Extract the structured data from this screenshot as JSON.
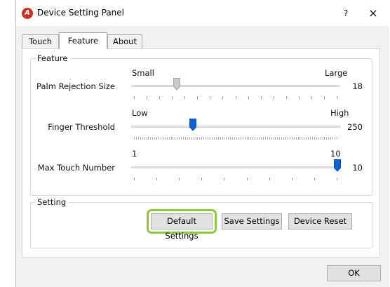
{
  "window": {
    "title": "Device Setting Panel",
    "help_symbol": "?",
    "close_symbol": "×",
    "icon": "app-logo-icon"
  },
  "tabs": [
    {
      "label": "Touch",
      "selected": false
    },
    {
      "label": "Feature",
      "selected": true
    },
    {
      "label": "About",
      "selected": false
    }
  ],
  "feature_group": {
    "title": "Feature",
    "sliders": [
      {
        "label": "Palm Rejection Size",
        "min_label": "Small",
        "max_label": "Large",
        "value": "18",
        "position_fraction": 0.21,
        "tick_count": 17,
        "thumb_style": "gray"
      },
      {
        "label": "Finger Threshold",
        "min_label": "Low",
        "max_label": "High",
        "value": "250",
        "position_fraction": 0.29,
        "tick_count": 100,
        "thumb_style": "blue"
      },
      {
        "label": "Max Touch Number",
        "min_label": "1",
        "max_label": "10",
        "value": "10",
        "position_fraction": 1.0,
        "tick_count": 10,
        "thumb_style": "blue"
      }
    ]
  },
  "setting_group": {
    "title": "Setting",
    "buttons": {
      "default": "Default Settings",
      "save": "Save Settings",
      "reset": "Device Reset"
    }
  },
  "footer": {
    "ok_label": "OK"
  },
  "colors": {
    "highlight": "#8dc63f",
    "thumb_blue": "#0a64d6",
    "thumb_gray": "#c9c9c9"
  }
}
